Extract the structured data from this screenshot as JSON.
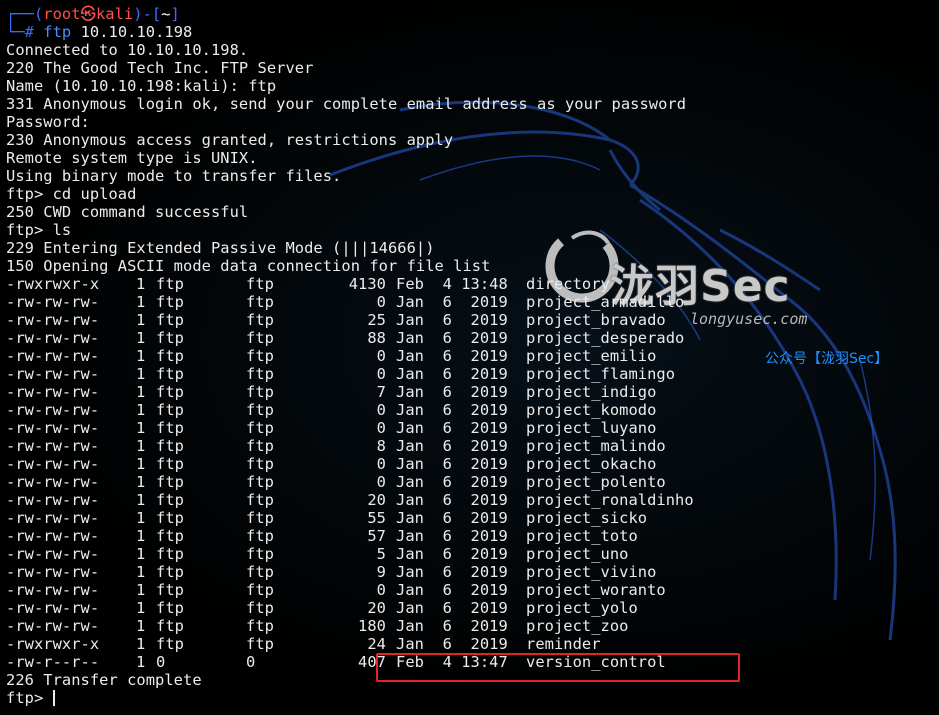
{
  "colors": {
    "background": "#000000",
    "text": "#ececec",
    "prompt_frame": "#3b6cff",
    "prompt_user": "#ff4f4f",
    "highlight_box": "#e0242a",
    "watermark_blue": "#1e90ff"
  },
  "prompt": {
    "frame_open": "┌──(",
    "user": "root",
    "at_symbol": "㉿",
    "host": "kali",
    "sep": ")-[",
    "path": "~",
    "frame_close": "]",
    "line2_prefix": "└─",
    "hash": "#",
    "command_name": "ftp",
    "command_args": " 10.10.10.198"
  },
  "session_lines": [
    "Connected to 10.10.10.198.",
    "220 The Good Tech Inc. FTP Server",
    "Name (10.10.10.198:kali): ftp",
    "331 Anonymous login ok, send your complete email address as your password",
    "Password:",
    "230 Anonymous access granted, restrictions apply",
    "Remote system type is UNIX.",
    "Using binary mode to transfer files.",
    "ftp> cd upload",
    "250 CWD command successful",
    "ftp> ls",
    "229 Entering Extended Passive Mode (|||14666|)",
    "150 Opening ASCII mode data connection for file list"
  ],
  "listing": [
    {
      "perm": "-rwxrwxr-x",
      "links": "1",
      "owner": "ftp",
      "group": "ftp",
      "size": "4130",
      "date": "Feb  4 13:48",
      "name": "directory"
    },
    {
      "perm": "-rw-rw-rw-",
      "links": "1",
      "owner": "ftp",
      "group": "ftp",
      "size": "0",
      "date": "Jan  6  2019",
      "name": "project_armadillo"
    },
    {
      "perm": "-rw-rw-rw-",
      "links": "1",
      "owner": "ftp",
      "group": "ftp",
      "size": "25",
      "date": "Jan  6  2019",
      "name": "project_bravado"
    },
    {
      "perm": "-rw-rw-rw-",
      "links": "1",
      "owner": "ftp",
      "group": "ftp",
      "size": "88",
      "date": "Jan  6  2019",
      "name": "project_desperado"
    },
    {
      "perm": "-rw-rw-rw-",
      "links": "1",
      "owner": "ftp",
      "group": "ftp",
      "size": "0",
      "date": "Jan  6  2019",
      "name": "project_emilio"
    },
    {
      "perm": "-rw-rw-rw-",
      "links": "1",
      "owner": "ftp",
      "group": "ftp",
      "size": "0",
      "date": "Jan  6  2019",
      "name": "project_flamingo"
    },
    {
      "perm": "-rw-rw-rw-",
      "links": "1",
      "owner": "ftp",
      "group": "ftp",
      "size": "7",
      "date": "Jan  6  2019",
      "name": "project_indigo"
    },
    {
      "perm": "-rw-rw-rw-",
      "links": "1",
      "owner": "ftp",
      "group": "ftp",
      "size": "0",
      "date": "Jan  6  2019",
      "name": "project_komodo"
    },
    {
      "perm": "-rw-rw-rw-",
      "links": "1",
      "owner": "ftp",
      "group": "ftp",
      "size": "0",
      "date": "Jan  6  2019",
      "name": "project_luyano"
    },
    {
      "perm": "-rw-rw-rw-",
      "links": "1",
      "owner": "ftp",
      "group": "ftp",
      "size": "8",
      "date": "Jan  6  2019",
      "name": "project_malindo"
    },
    {
      "perm": "-rw-rw-rw-",
      "links": "1",
      "owner": "ftp",
      "group": "ftp",
      "size": "0",
      "date": "Jan  6  2019",
      "name": "project_okacho"
    },
    {
      "perm": "-rw-rw-rw-",
      "links": "1",
      "owner": "ftp",
      "group": "ftp",
      "size": "0",
      "date": "Jan  6  2019",
      "name": "project_polento"
    },
    {
      "perm": "-rw-rw-rw-",
      "links": "1",
      "owner": "ftp",
      "group": "ftp",
      "size": "20",
      "date": "Jan  6  2019",
      "name": "project_ronaldinho"
    },
    {
      "perm": "-rw-rw-rw-",
      "links": "1",
      "owner": "ftp",
      "group": "ftp",
      "size": "55",
      "date": "Jan  6  2019",
      "name": "project_sicko"
    },
    {
      "perm": "-rw-rw-rw-",
      "links": "1",
      "owner": "ftp",
      "group": "ftp",
      "size": "57",
      "date": "Jan  6  2019",
      "name": "project_toto"
    },
    {
      "perm": "-rw-rw-rw-",
      "links": "1",
      "owner": "ftp",
      "group": "ftp",
      "size": "5",
      "date": "Jan  6  2019",
      "name": "project_uno"
    },
    {
      "perm": "-rw-rw-rw-",
      "links": "1",
      "owner": "ftp",
      "group": "ftp",
      "size": "9",
      "date": "Jan  6  2019",
      "name": "project_vivino"
    },
    {
      "perm": "-rw-rw-rw-",
      "links": "1",
      "owner": "ftp",
      "group": "ftp",
      "size": "0",
      "date": "Jan  6  2019",
      "name": "project_woranto"
    },
    {
      "perm": "-rw-rw-rw-",
      "links": "1",
      "owner": "ftp",
      "group": "ftp",
      "size": "20",
      "date": "Jan  6  2019",
      "name": "project_yolo"
    },
    {
      "perm": "-rw-rw-rw-",
      "links": "1",
      "owner": "ftp",
      "group": "ftp",
      "size": "180",
      "date": "Jan  6  2019",
      "name": "project_zoo"
    },
    {
      "perm": "-rwxrwxr-x",
      "links": "1",
      "owner": "ftp",
      "group": "ftp",
      "size": "24",
      "date": "Jan  6  2019",
      "name": "reminder"
    },
    {
      "perm": "-rw-r--r--",
      "links": "1",
      "owner": "0",
      "group": "0",
      "size": "407",
      "date": "Feb  4 13:47",
      "name": "version_control",
      "highlighted": true
    }
  ],
  "footer": {
    "transfer_status": "226 Transfer complete",
    "final_prompt": "ftp> "
  },
  "watermark": {
    "name": "泷羽Sec",
    "url": "longyusec.com",
    "account": "公众号【泷羽Sec】"
  }
}
